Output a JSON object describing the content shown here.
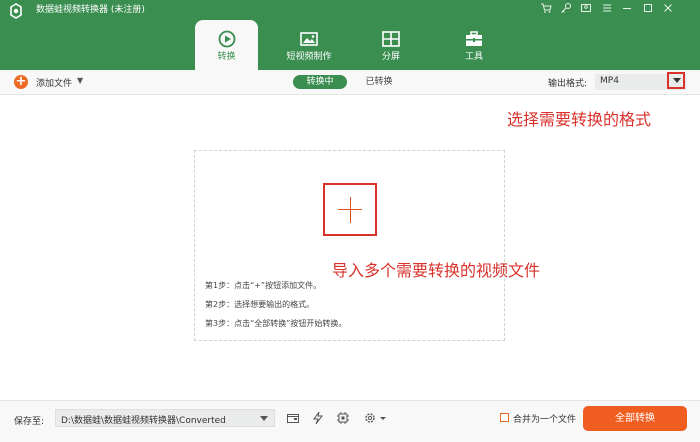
{
  "window": {
    "title": "数据蛙视频转换器 (未注册)",
    "controls": [
      "cart-icon",
      "key-icon",
      "account-icon",
      "menu-icon",
      "minimize-icon",
      "maximize-icon",
      "close-icon"
    ]
  },
  "nav": {
    "tabs": [
      {
        "label": "转换",
        "icon": "convert-icon",
        "active": true
      },
      {
        "label": "短视频制作",
        "icon": "short-video-icon",
        "active": false
      },
      {
        "label": "分屏",
        "icon": "split-screen-icon",
        "active": false
      },
      {
        "label": "工具",
        "icon": "toolbox-icon",
        "active": false
      }
    ]
  },
  "toolbar": {
    "add_file_label": "添加文件",
    "tab_converting": "转换中",
    "tab_converted": "已转换",
    "output_format_label": "输出格式:",
    "output_format_value": "MP4"
  },
  "annotations": {
    "format_hint": "选择需要转换的格式",
    "import_hint": "导入多个需要转换的视频文件"
  },
  "dropzone": {
    "steps": [
      "第1步：点击“+”按钮添加文件。",
      "第2步：选择想要输出的格式。",
      "第3步：点击“全部转换”按钮开始转换。"
    ]
  },
  "bottom": {
    "save_label": "保存至:",
    "save_path": "D:\\数据蛙\\数据蛙视频转换器\\Converted",
    "merge_label": "合并为一个文件",
    "convert_all_label": "全部转换"
  },
  "colors": {
    "header_green": "#3a8e50",
    "accent_orange": "#ef5d21",
    "annotation_red": "#d9322c"
  }
}
